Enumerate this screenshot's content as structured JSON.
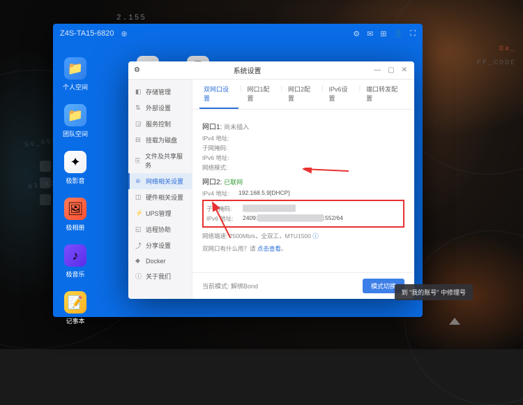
{
  "bg_labels": {
    "sv": "SV_058",
    "hz": "63 HZS",
    "da": "Da_",
    "ff": "FF_CODE",
    "num": "2.155"
  },
  "main_window": {
    "title": "Z4S-TA15-6820"
  },
  "desktop": [
    {
      "label": "个人空间"
    },
    {
      "label": "团队空间"
    },
    {
      "label": "极影音"
    },
    {
      "label": "极相册"
    },
    {
      "label": "极音乐"
    },
    {
      "label": "记事本"
    }
  ],
  "settings": {
    "title": "系统设置",
    "sidebar": [
      {
        "icon": "◧",
        "label": "存储管理"
      },
      {
        "icon": "⇅",
        "label": "外部设置"
      },
      {
        "icon": "◲",
        "label": "服务控制"
      },
      {
        "icon": "⊟",
        "label": "挂载为磁盘"
      },
      {
        "icon": "⎘",
        "label": "文件及共享服务"
      },
      {
        "icon": "⊕",
        "label": "网络相关设置"
      },
      {
        "icon": "◫",
        "label": "硬件相关设置"
      },
      {
        "icon": "⚡",
        "label": "UPS管理"
      },
      {
        "icon": "◱",
        "label": "远程协助"
      },
      {
        "icon": "⤴",
        "label": "分享设置"
      },
      {
        "icon": "◆",
        "label": "Docker"
      },
      {
        "icon": "ⓘ",
        "label": "关于我们"
      }
    ],
    "active_sidebar": 5,
    "tabs": [
      "双网口设置",
      "网口1配置",
      "网口2配置",
      "IPv6设置",
      "端口转发配置"
    ],
    "active_tab": 0,
    "port1": {
      "title": "网口1:",
      "status": "尚未插入",
      "rows": [
        {
          "k": "IPv4 地址:",
          "v": ""
        },
        {
          "k": "子网掩码:",
          "v": ""
        },
        {
          "k": "IPv6 地址:",
          "v": ""
        },
        {
          "k": "网络模式:",
          "v": ""
        }
      ]
    },
    "port2": {
      "title": "网口2:",
      "status": "已联网",
      "rows": [
        {
          "k": "IPv4 地址:",
          "v": "192.168.5.9[DHCP]"
        },
        {
          "k": "子网掩码:",
          "v_pre": "",
          "v_redact": "████████████",
          "v_post": ""
        },
        {
          "k": "IPv6 地址:",
          "v_pre": "2409:",
          "v_redact": "███████████████",
          "v_post": ":552/64"
        }
      ]
    },
    "speed": "网络端速:  2500Mb/s，全双工，MTU1500",
    "help": {
      "q": "双网口有什么用？请",
      "link": "点击查看",
      "tail": "。"
    },
    "footer": {
      "mode_label": "当前模式:",
      "mode_value": "解绑Bond",
      "button": "模式切换"
    }
  },
  "toast": "到 \"我的账号\" 中修理号"
}
